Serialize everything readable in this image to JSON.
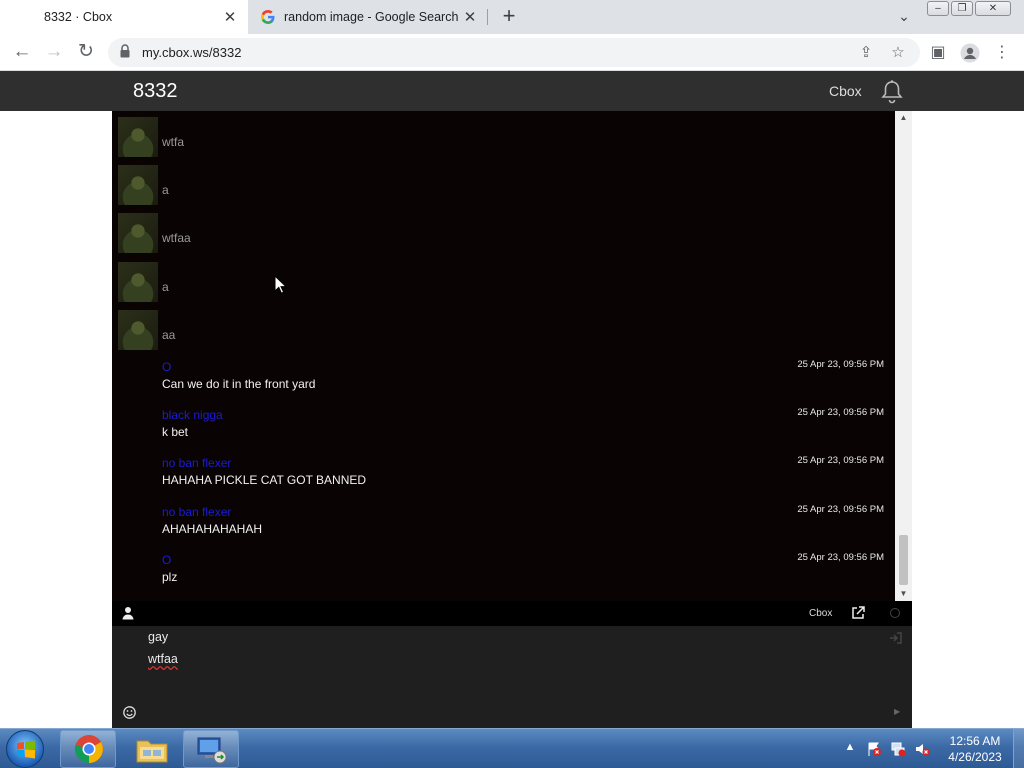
{
  "browser": {
    "tabs": [
      {
        "title": "8332 · Cbox",
        "active": true
      },
      {
        "title": "random image - Google Search",
        "active": false
      }
    ],
    "url": "my.cbox.ws/8332"
  },
  "site": {
    "title": "8332",
    "nav_link": "Cbox"
  },
  "messages": [
    {
      "name": "",
      "text": "wtfa",
      "time": "",
      "avatar": true
    },
    {
      "name": "",
      "text": "a",
      "time": "",
      "avatar": true
    },
    {
      "name": "",
      "text": "wtfaa",
      "time": "",
      "avatar": true
    },
    {
      "name": "",
      "text": "a",
      "time": "",
      "avatar": true
    },
    {
      "name": "",
      "text": "aa",
      "time": "",
      "avatar": true
    },
    {
      "name": "O",
      "text": "Can we do it in the front yard",
      "time": "25 Apr 23, 09:56 PM",
      "avatar": false
    },
    {
      "name": "black nigga",
      "text": "k bet",
      "time": "25 Apr 23, 09:56 PM",
      "avatar": false
    },
    {
      "name": "no ban flexer",
      "text": "HAHAHA PICKLE CAT GOT BANNED",
      "time": "25 Apr 23, 09:56 PM",
      "avatar": false
    },
    {
      "name": "no ban flexer",
      "text": "AHAHAHAHAHAH",
      "time": "25 Apr 23, 09:56 PM",
      "avatar": false
    },
    {
      "name": "O",
      "text": "plz",
      "time": "25 Apr 23, 09:56 PM",
      "avatar": false
    }
  ],
  "chat_bar": {
    "brand": "Cbox"
  },
  "input": {
    "lines": [
      "gay",
      "wtfaa"
    ]
  },
  "taskbar": {
    "time": "12:56 AM",
    "date": "4/26/2023"
  },
  "colors": {
    "chat_bg": "#0a0304",
    "name_link": "#1b1bd6",
    "header_bg": "#2f2f2f"
  }
}
